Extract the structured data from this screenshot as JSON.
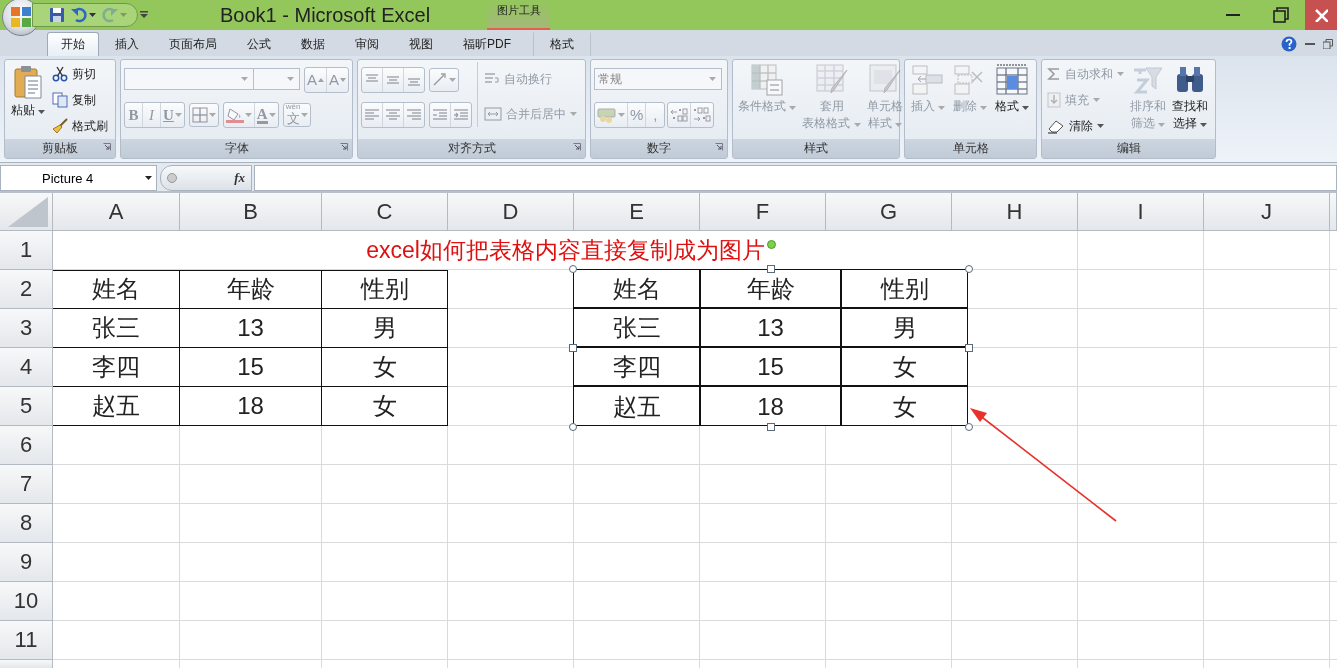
{
  "window": {
    "title": "Book1 - Microsoft Excel",
    "contextual_group": "图片工具"
  },
  "quick_access": {
    "redo_disabled": true
  },
  "ribbon_tabs": [
    {
      "label": "开始",
      "selected": true
    },
    {
      "label": "插入",
      "selected": false
    },
    {
      "label": "页面布局",
      "selected": false
    },
    {
      "label": "公式",
      "selected": false
    },
    {
      "label": "数据",
      "selected": false
    },
    {
      "label": "审阅",
      "selected": false
    },
    {
      "label": "视图",
      "selected": false
    },
    {
      "label": "福昕PDF",
      "selected": false
    },
    {
      "label": "格式",
      "selected": false
    }
  ],
  "ribbon": {
    "groups": [
      {
        "title": "剪贴板",
        "columns": [
          {
            "kind": "large",
            "label_lines": [
              "粘贴"
            ],
            "dropdown": true,
            "disabled": false
          },
          {
            "kind": "stack",
            "rows": [
              [
                [
                  {
                    "kind": "small",
                    "label": "剪切",
                    "dropdown": false,
                    "disabled": false
                  }
                ]
              ],
              [
                [
                  {
                    "kind": "small",
                    "label": "复制",
                    "dropdown": false,
                    "disabled": false
                  }
                ]
              ],
              [
                [
                  {
                    "kind": "small",
                    "label": "格式刷",
                    "dropdown": false,
                    "disabled": false
                  }
                ]
              ]
            ]
          }
        ]
      },
      {
        "title": "字体",
        "columns": [
          {
            "kind": "stack",
            "rows": [
              [
                [
                  {
                    "kind": "field",
                    "dropdown": true,
                    "disabled": true
                  },
                  {
                    "kind": "field",
                    "dropdown": true,
                    "disabled": true
                  }
                ],
                [
                  {
                    "kind": "icon",
                    "glyph": "A",
                    "dropdown": false,
                    "disabled": true
                  },
                  {
                    "kind": "icon",
                    "glyph": "A",
                    "dropdown": false,
                    "disabled": true
                  }
                ]
              ],
              [
                [
                  {
                    "kind": "icon",
                    "glyph": "B",
                    "dropdown": false,
                    "disabled": true
                  },
                  {
                    "kind": "icon",
                    "glyph": "I",
                    "dropdown": false,
                    "disabled": true
                  },
                  {
                    "kind": "icon",
                    "glyph": "U",
                    "dropdown": true,
                    "disabled": true
                  }
                ],
                [
                  {
                    "kind": "icon",
                    "dropdown": true,
                    "disabled": true
                  }
                ],
                [
                  {
                    "kind": "icon",
                    "dropdown": true,
                    "disabled": true
                  },
                  {
                    "kind": "icon",
                    "glyph": "A",
                    "dropdown": true,
                    "disabled": true
                  }
                ],
                [
                  {
                    "kind": "icon",
                    "glyph": "文",
                    "ruby": "wén",
                    "dropdown": true,
                    "disabled": true
                  }
                ]
              ]
            ]
          }
        ]
      },
      {
        "title": "对齐方式",
        "columns": [
          {
            "kind": "stack",
            "rows": [
              [
                [
                  {
                    "kind": "icon",
                    "dropdown": false,
                    "disabled": true
                  },
                  {
                    "kind": "icon",
                    "dropdown": false,
                    "disabled": true
                  },
                  {
                    "kind": "icon",
                    "dropdown": false,
                    "disabled": true
                  }
                ],
                [
                  {
                    "kind": "icon",
                    "dropdown": true,
                    "disabled": true
                  }
                ]
              ],
              [
                [
                  {
                    "kind": "icon",
                    "dropdown": false,
                    "disabled": true
                  },
                  {
                    "kind": "icon",
                    "dropdown": false,
                    "disabled": true
                  },
                  {
                    "kind": "icon",
                    "dropdown": false,
                    "disabled": true
                  }
                ],
                [
                  {
                    "kind": "icon",
                    "dropdown": false,
                    "disabled": true
                  },
                  {
                    "kind": "icon",
                    "dropdown": false,
                    "disabled": true
                  }
                ]
              ]
            ]
          },
          {
            "kind": "stack",
            "rows": [
              [
                [
                  {
                    "kind": "small",
                    "label": "自动换行",
                    "dropdown": false,
                    "disabled": true
                  }
                ]
              ],
              [
                [
                  {
                    "kind": "small",
                    "label": "合并后居中",
                    "dropdown": true,
                    "disabled": true
                  }
                ]
              ]
            ]
          }
        ]
      },
      {
        "title": "数字",
        "columns": [
          {
            "kind": "stack",
            "rows": [
              [
                [
                  {
                    "kind": "field",
                    "value": "常规",
                    "dropdown": true,
                    "disabled": true
                  }
                ]
              ],
              [
                [
                  {
                    "kind": "icon",
                    "dropdown": true,
                    "disabled": true
                  },
                  {
                    "kind": "icon",
                    "glyph": "%",
                    "dropdown": false,
                    "disabled": true
                  },
                  {
                    "kind": "icon",
                    "glyph": ",",
                    "dropdown": false,
                    "disabled": true
                  }
                ],
                [
                  {
                    "kind": "icon",
                    "dropdown": false,
                    "disabled": true
                  },
                  {
                    "kind": "icon",
                    "dropdown": false,
                    "disabled": true
                  }
                ]
              ]
            ]
          }
        ]
      },
      {
        "title": "样式",
        "columns": [
          {
            "kind": "large",
            "label_lines": [
              "条件格式"
            ],
            "dropdown": true,
            "disabled": true
          },
          {
            "kind": "large",
            "label_lines": [
              "套用",
              "表格格式"
            ],
            "dropdown": true,
            "disabled": true
          },
          {
            "kind": "large",
            "label_lines": [
              "单元格",
              "样式"
            ],
            "dropdown": true,
            "disabled": true
          }
        ]
      },
      {
        "title": "单元格",
        "columns": [
          {
            "kind": "large",
            "label_lines": [
              "插入"
            ],
            "dropdown": true,
            "disabled": true
          },
          {
            "kind": "large",
            "label_lines": [
              "删除"
            ],
            "dropdown": true,
            "disabled": true
          },
          {
            "kind": "large",
            "label_lines": [
              "格式"
            ],
            "dropdown": true,
            "disabled": false
          }
        ]
      },
      {
        "title": "编辑",
        "columns": [
          {
            "kind": "stack",
            "rows": [
              [
                [
                  {
                    "kind": "small",
                    "label": "自动求和",
                    "dropdown": true,
                    "disabled": true
                  }
                ]
              ],
              [
                [
                  {
                    "kind": "small",
                    "label": "填充",
                    "dropdown": true,
                    "disabled": true
                  }
                ]
              ],
              [
                [
                  {
                    "kind": "small",
                    "label": "清除",
                    "dropdown": true,
                    "disabled": false
                  }
                ]
              ]
            ]
          },
          {
            "kind": "large",
            "label_lines": [
              "排序和",
              "筛选"
            ],
            "dropdown": true,
            "disabled": true
          },
          {
            "kind": "large",
            "label_lines": [
              "查找和",
              "选择"
            ],
            "dropdown": true,
            "disabled": false
          }
        ]
      }
    ]
  },
  "formula_bar": {
    "name_box": "Picture 4",
    "function_label": "fx"
  },
  "sheet": {
    "columns": [
      "A",
      "B",
      "C",
      "D",
      "E",
      "F",
      "G",
      "H",
      "I",
      "J"
    ],
    "rows": [
      "1",
      "2",
      "3",
      "4",
      "5",
      "6",
      "7",
      "8",
      "9",
      "10",
      "11"
    ],
    "title": "excel如何把表格内容直接复制成为图片",
    "table": [
      [
        "姓名",
        "年龄",
        "性别"
      ],
      [
        "张三",
        "13",
        "男"
      ],
      [
        "李四",
        "15",
        "女"
      ],
      [
        "赵五",
        "18",
        "女"
      ]
    ]
  },
  "picture": {
    "selected": true,
    "table": [
      [
        "姓名",
        "年龄",
        "性别"
      ],
      [
        "张三",
        "13",
        "男"
      ],
      [
        "李四",
        "15",
        "女"
      ],
      [
        "赵五",
        "18",
        "女"
      ]
    ]
  }
}
